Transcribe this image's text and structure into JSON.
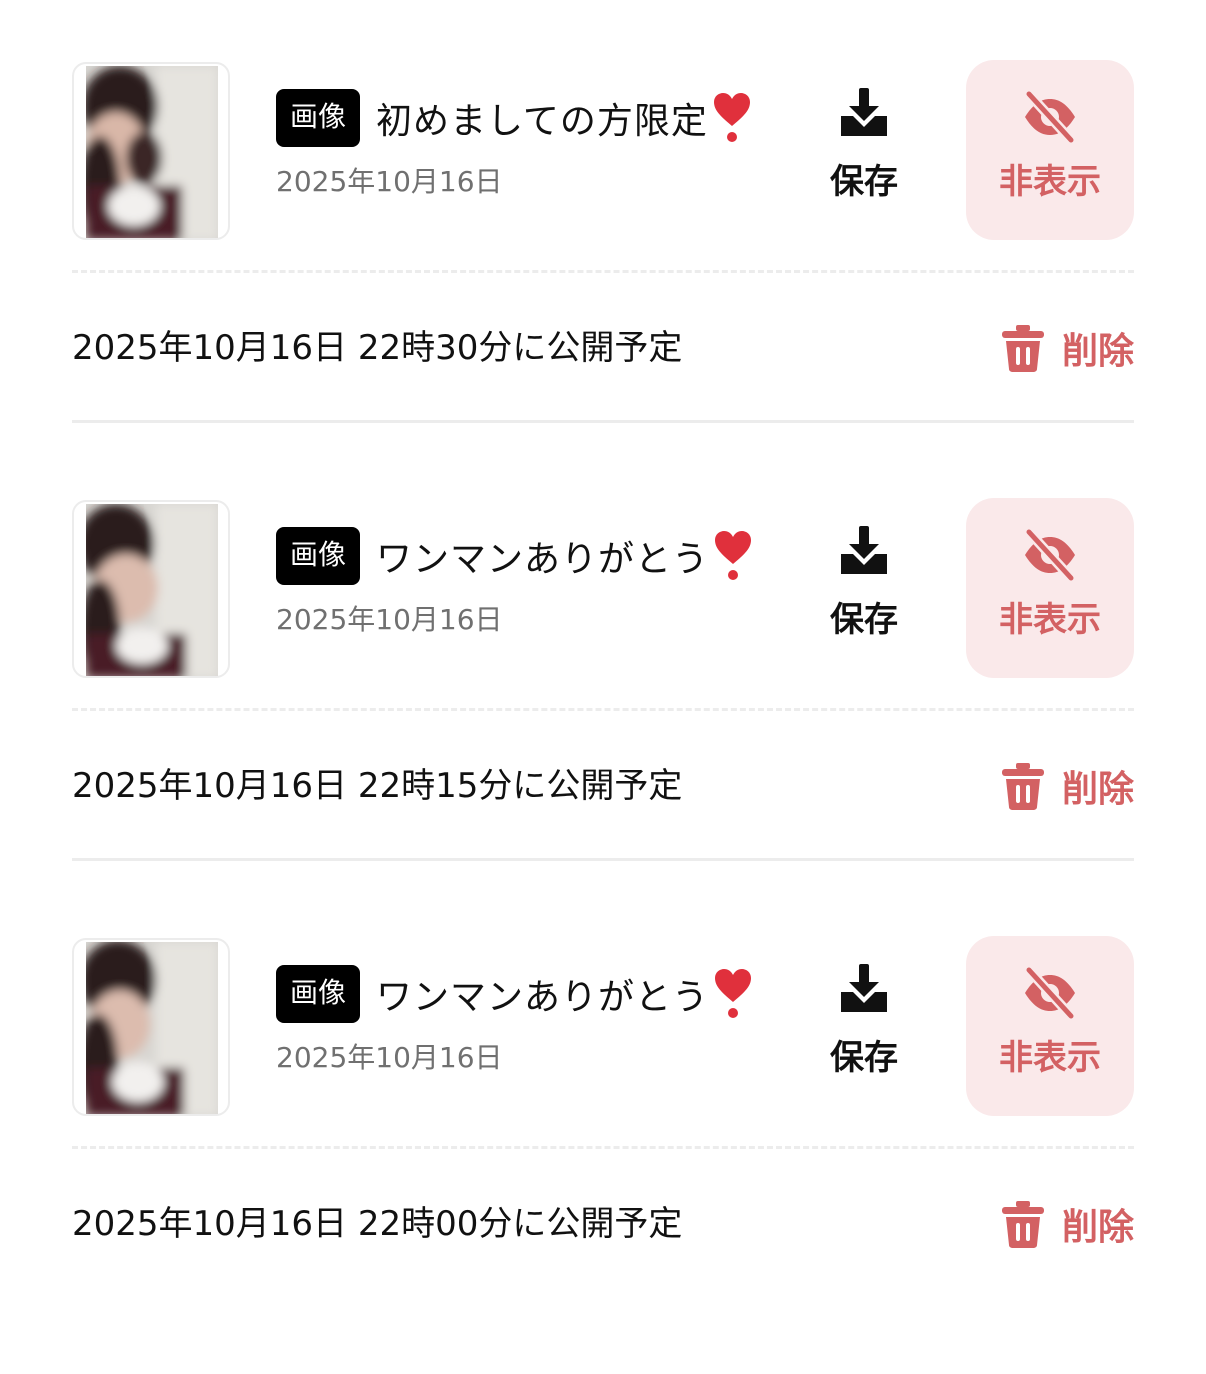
{
  "colors": {
    "accent": "#d36163",
    "hide_bg": "#fae9ea",
    "badge_bg": "#000000",
    "date_text": "#707070",
    "divider": "#ececec"
  },
  "posts": [
    {
      "badge": "画像",
      "title": "初めましての方限定",
      "title_emoji_icon": "heart-exclamation-icon",
      "date": "2025年10月16日",
      "save_icon": "download-tray-icon",
      "save_label": "保存",
      "hide_icon": "eye-slash-icon",
      "hide_label": "非表示",
      "schedule": "2025年10月16日 22時30分に公開予定",
      "delete_icon": "trash-icon",
      "delete_label": "削除"
    },
    {
      "badge": "画像",
      "title": "ワンマンありがとう",
      "title_emoji_icon": "heart-exclamation-icon",
      "date": "2025年10月16日",
      "save_icon": "download-tray-icon",
      "save_label": "保存",
      "hide_icon": "eye-slash-icon",
      "hide_label": "非表示",
      "schedule": "2025年10月16日 22時15分に公開予定",
      "delete_icon": "trash-icon",
      "delete_label": "削除"
    },
    {
      "badge": "画像",
      "title": "ワンマンありがとう",
      "title_emoji_icon": "heart-exclamation-icon",
      "date": "2025年10月16日",
      "save_icon": "download-tray-icon",
      "save_label": "保存",
      "hide_icon": "eye-slash-icon",
      "hide_label": "非表示",
      "schedule": "2025年10月16日 22時00分に公開予定",
      "delete_icon": "trash-icon",
      "delete_label": "削除"
    }
  ]
}
